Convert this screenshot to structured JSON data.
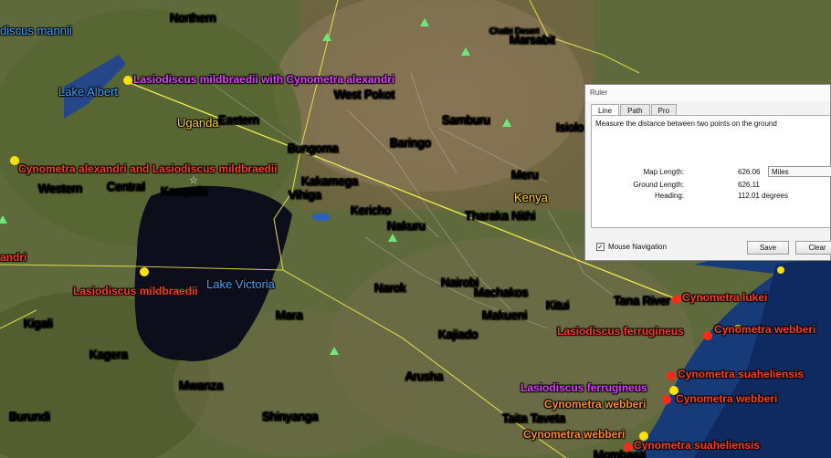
{
  "map": {
    "places": [
      {
        "text": "Northern",
        "cls": "place"
      },
      {
        "text": "Marsabit",
        "cls": "place"
      },
      {
        "text": "Chalbi Desert",
        "cls": "place"
      },
      {
        "text": "West Pokot",
        "cls": "place"
      },
      {
        "text": "Eastern",
        "cls": "place"
      },
      {
        "text": "Samburu",
        "cls": "place"
      },
      {
        "text": "Isiolo",
        "cls": "place"
      },
      {
        "text": "Bungoma",
        "cls": "place"
      },
      {
        "text": "Baringo",
        "cls": "place"
      },
      {
        "text": "Meru",
        "cls": "place"
      },
      {
        "text": "Western",
        "cls": "place"
      },
      {
        "text": "Central",
        "cls": "place"
      },
      {
        "text": "Kampala",
        "cls": "place"
      },
      {
        "text": "Kakamega",
        "cls": "place"
      },
      {
        "text": "Vihiga",
        "cls": "place"
      },
      {
        "text": "Kericho",
        "cls": "place"
      },
      {
        "text": "Nakuru",
        "cls": "place"
      },
      {
        "text": "Tharaka Nithi",
        "cls": "place"
      },
      {
        "text": "Narok",
        "cls": "place"
      },
      {
        "text": "Nairobi",
        "cls": "place"
      },
      {
        "text": "Machakos",
        "cls": "place"
      },
      {
        "text": "Kitui",
        "cls": "place"
      },
      {
        "text": "Tana River",
        "cls": "place"
      },
      {
        "text": "Mara",
        "cls": "place"
      },
      {
        "text": "Makueni",
        "cls": "place"
      },
      {
        "text": "Kigali",
        "cls": "place"
      },
      {
        "text": "Kajiado",
        "cls": "place"
      },
      {
        "text": "Kagera",
        "cls": "place"
      },
      {
        "text": "Arusha",
        "cls": "place"
      },
      {
        "text": "Mwanza",
        "cls": "place"
      },
      {
        "text": "Taita Taveta",
        "cls": "place"
      },
      {
        "text": "Burundi",
        "cls": "place"
      },
      {
        "text": "Shinyanga",
        "cls": "place"
      },
      {
        "text": "Mombasa",
        "cls": "place"
      },
      {
        "text": "Lake Albert",
        "cls": "water"
      },
      {
        "text": "Lake Victoria",
        "cls": "water"
      },
      {
        "text": "Uganda",
        "cls": "country"
      },
      {
        "text": "Kenya",
        "cls": "country"
      }
    ],
    "species_labels": [
      {
        "text": "discus mannii",
        "cls": "water"
      },
      {
        "text": "Lasiodiscus mildbraedii with Cynometra alexandri",
        "cls": "sp-mag"
      },
      {
        "text": "Cynometra alexandri and Lasiodiscus mildbraedii",
        "cls": "sp-red"
      },
      {
        "text": "andri",
        "cls": "sp-red"
      },
      {
        "text": "Lasiodiscus mildbraedii",
        "cls": "sp-red"
      },
      {
        "text": "Cynometra lukei",
        "cls": "sp-red"
      },
      {
        "text": "Lasiodiscus ferrugineus",
        "cls": "sp-red"
      },
      {
        "text": "Cynometra webberi",
        "cls": "sp-red"
      },
      {
        "text": "Cynometra suaheliensis",
        "cls": "sp-red"
      },
      {
        "text": "Lasiodiscus ferrugineus",
        "cls": "sp-mag"
      },
      {
        "text": "Cynometra webberi",
        "cls": "sp-org"
      },
      {
        "text": "Cynometra webberi",
        "cls": "sp-red"
      },
      {
        "text": "Cynometra webberi",
        "cls": "sp-org"
      },
      {
        "text": "Cynometra suaheliensis",
        "cls": "sp-red"
      }
    ]
  },
  "ruler": {
    "title": "Ruler",
    "tabs": [
      "Line",
      "Path",
      "Pro"
    ],
    "description": "Measure the distance between two points on the ground",
    "map_length_label": "Map Length:",
    "map_length_value": "626.06",
    "unit": "Miles",
    "ground_length_label": "Ground Length:",
    "ground_length_value": "626.11",
    "heading_label": "Heading:",
    "heading_value": "112.01 degrees",
    "mouse_nav_label": "Mouse Navigation",
    "save_label": "Save",
    "clear_label": "Clear"
  }
}
